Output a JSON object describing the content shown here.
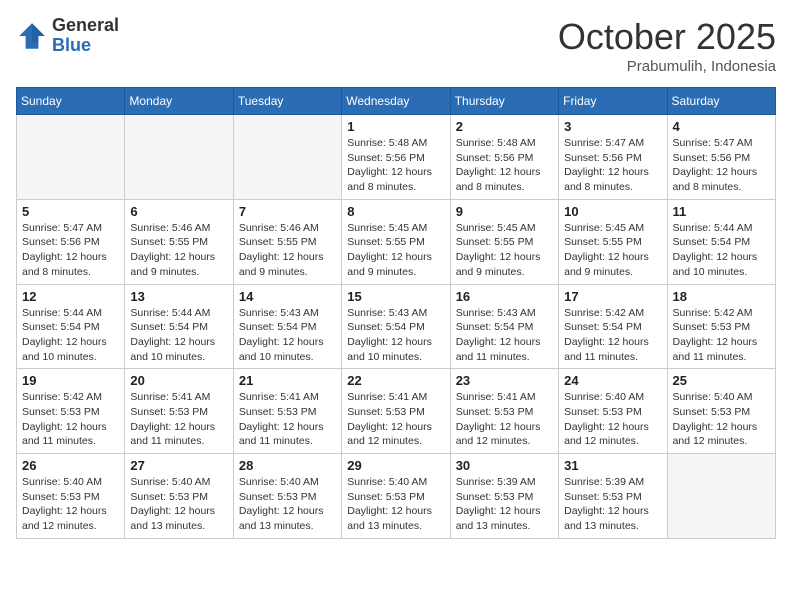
{
  "logo": {
    "general": "General",
    "blue": "Blue"
  },
  "header": {
    "month": "October 2025",
    "location": "Prabumulih, Indonesia"
  },
  "weekdays": [
    "Sunday",
    "Monday",
    "Tuesday",
    "Wednesday",
    "Thursday",
    "Friday",
    "Saturday"
  ],
  "weeks": [
    [
      {
        "day": "",
        "info": ""
      },
      {
        "day": "",
        "info": ""
      },
      {
        "day": "",
        "info": ""
      },
      {
        "day": "1",
        "info": "Sunrise: 5:48 AM\nSunset: 5:56 PM\nDaylight: 12 hours\nand 8 minutes."
      },
      {
        "day": "2",
        "info": "Sunrise: 5:48 AM\nSunset: 5:56 PM\nDaylight: 12 hours\nand 8 minutes."
      },
      {
        "day": "3",
        "info": "Sunrise: 5:47 AM\nSunset: 5:56 PM\nDaylight: 12 hours\nand 8 minutes."
      },
      {
        "day": "4",
        "info": "Sunrise: 5:47 AM\nSunset: 5:56 PM\nDaylight: 12 hours\nand 8 minutes."
      }
    ],
    [
      {
        "day": "5",
        "info": "Sunrise: 5:47 AM\nSunset: 5:56 PM\nDaylight: 12 hours\nand 8 minutes."
      },
      {
        "day": "6",
        "info": "Sunrise: 5:46 AM\nSunset: 5:55 PM\nDaylight: 12 hours\nand 9 minutes."
      },
      {
        "day": "7",
        "info": "Sunrise: 5:46 AM\nSunset: 5:55 PM\nDaylight: 12 hours\nand 9 minutes."
      },
      {
        "day": "8",
        "info": "Sunrise: 5:45 AM\nSunset: 5:55 PM\nDaylight: 12 hours\nand 9 minutes."
      },
      {
        "day": "9",
        "info": "Sunrise: 5:45 AM\nSunset: 5:55 PM\nDaylight: 12 hours\nand 9 minutes."
      },
      {
        "day": "10",
        "info": "Sunrise: 5:45 AM\nSunset: 5:55 PM\nDaylight: 12 hours\nand 9 minutes."
      },
      {
        "day": "11",
        "info": "Sunrise: 5:44 AM\nSunset: 5:54 PM\nDaylight: 12 hours\nand 10 minutes."
      }
    ],
    [
      {
        "day": "12",
        "info": "Sunrise: 5:44 AM\nSunset: 5:54 PM\nDaylight: 12 hours\nand 10 minutes."
      },
      {
        "day": "13",
        "info": "Sunrise: 5:44 AM\nSunset: 5:54 PM\nDaylight: 12 hours\nand 10 minutes."
      },
      {
        "day": "14",
        "info": "Sunrise: 5:43 AM\nSunset: 5:54 PM\nDaylight: 12 hours\nand 10 minutes."
      },
      {
        "day": "15",
        "info": "Sunrise: 5:43 AM\nSunset: 5:54 PM\nDaylight: 12 hours\nand 10 minutes."
      },
      {
        "day": "16",
        "info": "Sunrise: 5:43 AM\nSunset: 5:54 PM\nDaylight: 12 hours\nand 11 minutes."
      },
      {
        "day": "17",
        "info": "Sunrise: 5:42 AM\nSunset: 5:54 PM\nDaylight: 12 hours\nand 11 minutes."
      },
      {
        "day": "18",
        "info": "Sunrise: 5:42 AM\nSunset: 5:53 PM\nDaylight: 12 hours\nand 11 minutes."
      }
    ],
    [
      {
        "day": "19",
        "info": "Sunrise: 5:42 AM\nSunset: 5:53 PM\nDaylight: 12 hours\nand 11 minutes."
      },
      {
        "day": "20",
        "info": "Sunrise: 5:41 AM\nSunset: 5:53 PM\nDaylight: 12 hours\nand 11 minutes."
      },
      {
        "day": "21",
        "info": "Sunrise: 5:41 AM\nSunset: 5:53 PM\nDaylight: 12 hours\nand 11 minutes."
      },
      {
        "day": "22",
        "info": "Sunrise: 5:41 AM\nSunset: 5:53 PM\nDaylight: 12 hours\nand 12 minutes."
      },
      {
        "day": "23",
        "info": "Sunrise: 5:41 AM\nSunset: 5:53 PM\nDaylight: 12 hours\nand 12 minutes."
      },
      {
        "day": "24",
        "info": "Sunrise: 5:40 AM\nSunset: 5:53 PM\nDaylight: 12 hours\nand 12 minutes."
      },
      {
        "day": "25",
        "info": "Sunrise: 5:40 AM\nSunset: 5:53 PM\nDaylight: 12 hours\nand 12 minutes."
      }
    ],
    [
      {
        "day": "26",
        "info": "Sunrise: 5:40 AM\nSunset: 5:53 PM\nDaylight: 12 hours\nand 12 minutes."
      },
      {
        "day": "27",
        "info": "Sunrise: 5:40 AM\nSunset: 5:53 PM\nDaylight: 12 hours\nand 13 minutes."
      },
      {
        "day": "28",
        "info": "Sunrise: 5:40 AM\nSunset: 5:53 PM\nDaylight: 12 hours\nand 13 minutes."
      },
      {
        "day": "29",
        "info": "Sunrise: 5:40 AM\nSunset: 5:53 PM\nDaylight: 12 hours\nand 13 minutes."
      },
      {
        "day": "30",
        "info": "Sunrise: 5:39 AM\nSunset: 5:53 PM\nDaylight: 12 hours\nand 13 minutes."
      },
      {
        "day": "31",
        "info": "Sunrise: 5:39 AM\nSunset: 5:53 PM\nDaylight: 12 hours\nand 13 minutes."
      },
      {
        "day": "",
        "info": ""
      }
    ]
  ]
}
